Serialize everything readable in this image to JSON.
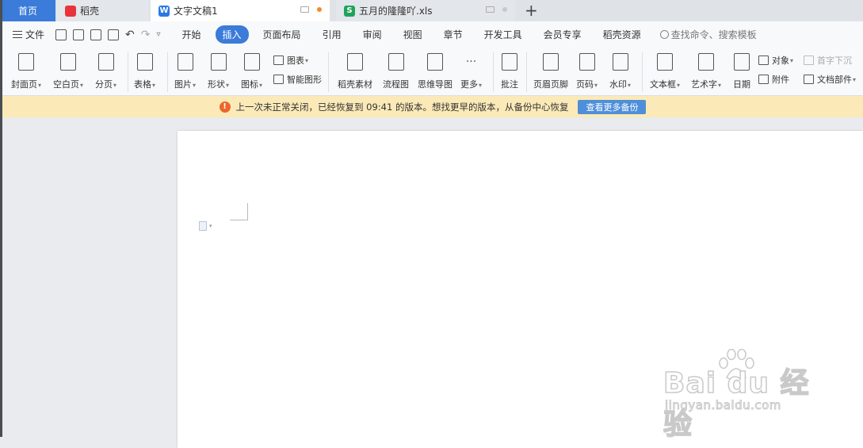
{
  "tabs": {
    "home": "首页",
    "daoke": "稻壳",
    "doc": "文字文稿1",
    "xls": "五月的隆隆吖.xls",
    "new_tab": "+"
  },
  "menu": {
    "file": "文件",
    "tabs": [
      "开始",
      "插入",
      "页面布局",
      "引用",
      "审阅",
      "视图",
      "章节",
      "开发工具",
      "会员专享",
      "稻壳资源"
    ],
    "active_tab": "插入",
    "search": "查找命令、搜索模板"
  },
  "ribbon": {
    "cover": "封面页",
    "blank": "空白页",
    "pagebreak": "分页",
    "table": "表格",
    "picture": "图片",
    "shape": "形状",
    "icon": "图标",
    "chart": "图表",
    "smartart": "智能图形",
    "material": "稻壳素材",
    "flowchart": "流程图",
    "mindmap": "思维导图",
    "more": "更多",
    "comment": "批注",
    "header_footer": "页眉页脚",
    "page_number": "页码",
    "watermark": "水印",
    "textbox": "文本框",
    "wordart": "艺术字",
    "date": "日期",
    "object": "对象",
    "attachment": "附件",
    "dropcap": "首字下沉",
    "docparts": "文档部件"
  },
  "notice": {
    "text": "上一次未正常关闭，已经恢复到 09:41 的版本。想找更早的版本，从备份中心恢复",
    "button": "查看更多备份"
  },
  "watermark": {
    "brand": "Bai du 经验",
    "url": "jingyan.baidu.com"
  },
  "colors": {
    "accent": "#3b7bd9",
    "notice_bg": "#fbeab8",
    "warn": "#e9682c"
  }
}
